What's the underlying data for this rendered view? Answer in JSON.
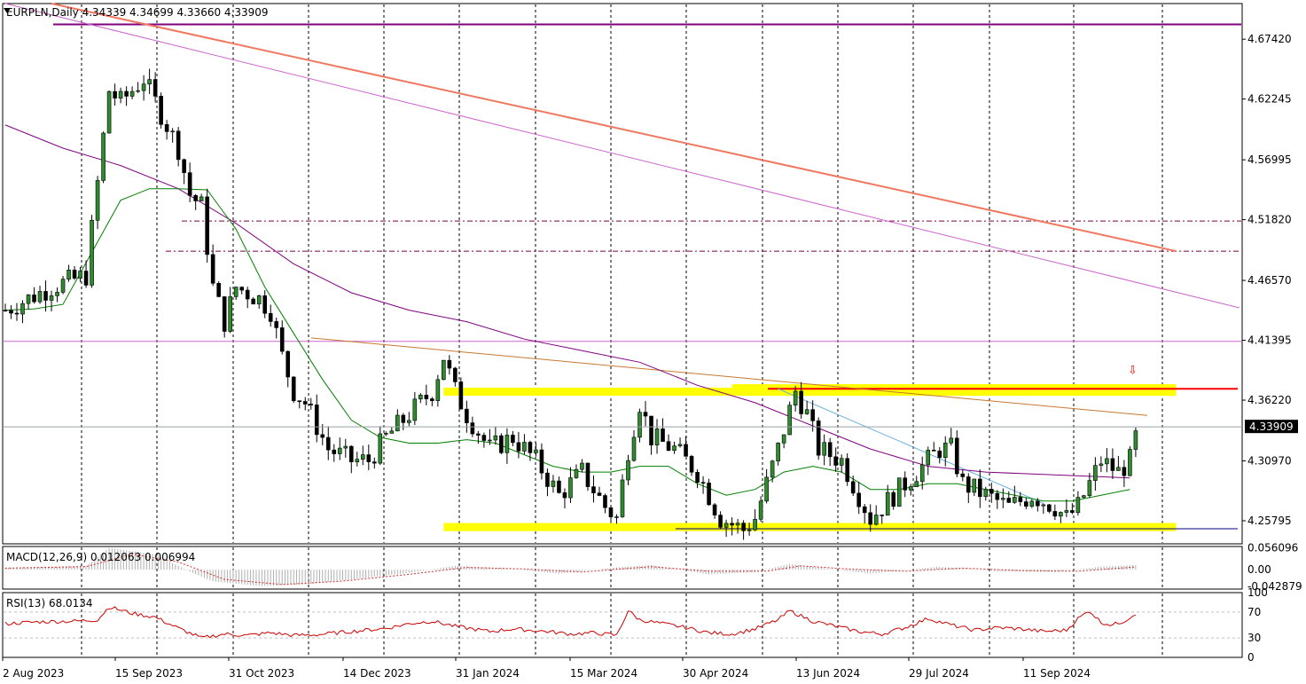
{
  "chart_data": [
    {
      "type": "candlestick",
      "symbol": "EURPLN",
      "timeframe": "Daily",
      "ohlc_header": {
        "open": "4.34339",
        "high": "4.34699",
        "low": "4.33660",
        "close": "4.33909"
      },
      "header_text": "EURPLN,Daily  4.34339 4.34699 4.33660 4.33909",
      "last_price": "4.33909",
      "ylim": [
        4.238,
        4.705
      ],
      "y_ticks": [
        "4.67420",
        "4.62245",
        "4.56995",
        "4.51820",
        "4.46570",
        "4.41395",
        "4.36220",
        "4.30970",
        "4.25795"
      ],
      "x_ticks": [
        "2 Aug 2023",
        "15 Sep 2023",
        "31 Oct 2023",
        "14 Dec 2023",
        "31 Jan 2024",
        "15 Mar 2024",
        "30 Apr 2024",
        "13 Jun 2024",
        "29 Jul 2024",
        "11 Sep 2024"
      ],
      "close_path": [
        [
          0,
          4.44
        ],
        [
          8,
          4.46
        ],
        [
          14,
          4.47
        ],
        [
          18,
          4.63
        ],
        [
          20,
          4.62
        ],
        [
          24,
          4.64
        ],
        [
          27,
          4.61
        ],
        [
          30,
          4.58
        ],
        [
          32,
          4.54
        ],
        [
          34,
          4.53
        ],
        [
          36,
          4.46
        ],
        [
          38,
          4.43
        ],
        [
          40,
          4.46
        ],
        [
          44,
          4.45
        ],
        [
          46,
          4.44
        ],
        [
          48,
          4.4
        ],
        [
          50,
          4.37
        ],
        [
          52,
          4.36
        ],
        [
          56,
          4.32
        ],
        [
          60,
          4.31
        ],
        [
          63,
          4.31
        ],
        [
          66,
          4.33
        ],
        [
          70,
          4.35
        ],
        [
          74,
          4.37
        ],
        [
          76,
          4.4
        ],
        [
          78,
          4.37
        ],
        [
          80,
          4.35
        ],
        [
          84,
          4.32
        ],
        [
          88,
          4.33
        ],
        [
          92,
          4.31
        ],
        [
          96,
          4.28
        ],
        [
          100,
          4.3
        ],
        [
          104,
          4.27
        ],
        [
          106,
          4.26
        ],
        [
          108,
          4.32
        ],
        [
          110,
          4.36
        ],
        [
          112,
          4.33
        ],
        [
          116,
          4.32
        ],
        [
          120,
          4.3
        ],
        [
          124,
          4.26
        ],
        [
          128,
          4.25
        ],
        [
          130,
          4.26
        ],
        [
          134,
          4.32
        ],
        [
          137,
          4.37
        ],
        [
          139,
          4.35
        ],
        [
          141,
          4.32
        ],
        [
          145,
          4.31
        ],
        [
          148,
          4.28
        ],
        [
          150,
          4.26
        ],
        [
          154,
          4.28
        ],
        [
          158,
          4.3
        ],
        [
          162,
          4.32
        ],
        [
          164,
          4.32
        ],
        [
          166,
          4.29
        ],
        [
          170,
          4.28
        ],
        [
          174,
          4.27
        ],
        [
          178,
          4.28
        ],
        [
          182,
          4.27
        ],
        [
          184,
          4.26
        ],
        [
          186,
          4.27
        ],
        [
          188,
          4.29
        ],
        [
          190,
          4.31
        ],
        [
          193,
          4.3
        ],
        [
          195,
          4.31
        ],
        [
          196,
          4.33
        ]
      ],
      "moving_averages": [
        {
          "color": "#800080",
          "points": [
            [
              0,
              4.6
            ],
            [
              10,
              4.58
            ],
            [
              20,
              4.565
            ],
            [
              30,
              4.545
            ],
            [
              40,
              4.515
            ],
            [
              50,
              4.48
            ],
            [
              60,
              4.455
            ],
            [
              70,
              4.44
            ],
            [
              80,
              4.43
            ],
            [
              90,
              4.415
            ],
            [
              100,
              4.405
            ],
            [
              110,
              4.395
            ],
            [
              120,
              4.375
            ],
            [
              130,
              4.36
            ],
            [
              140,
              4.34
            ],
            [
              150,
              4.32
            ],
            [
              160,
              4.305
            ],
            [
              170,
              4.3
            ],
            [
              180,
              4.298
            ],
            [
              190,
              4.296
            ],
            [
              195,
              4.295
            ]
          ]
        },
        {
          "color": "#008000",
          "points": [
            [
              0,
              4.44
            ],
            [
              5,
              4.441
            ],
            [
              10,
              4.445
            ],
            [
              15,
              4.49
            ],
            [
              20,
              4.535
            ],
            [
              25,
              4.545
            ],
            [
              30,
              4.545
            ],
            [
              35,
              4.544
            ],
            [
              40,
              4.51
            ],
            [
              45,
              4.46
            ],
            [
              50,
              4.42
            ],
            [
              55,
              4.38
            ],
            [
              60,
              4.345
            ],
            [
              65,
              4.33
            ],
            [
              70,
              4.325
            ],
            [
              75,
              4.325
            ],
            [
              80,
              4.328
            ],
            [
              85,
              4.325
            ],
            [
              90,
              4.315
            ],
            [
              95,
              4.305
            ],
            [
              100,
              4.3
            ],
            [
              105,
              4.3
            ],
            [
              110,
              4.305
            ],
            [
              115,
              4.305
            ],
            [
              120,
              4.29
            ],
            [
              125,
              4.28
            ],
            [
              130,
              4.285
            ],
            [
              135,
              4.3
            ],
            [
              140,
              4.305
            ],
            [
              145,
              4.3
            ],
            [
              150,
              4.285
            ],
            [
              155,
              4.285
            ],
            [
              160,
              4.29
            ],
            [
              165,
              4.29
            ],
            [
              170,
              4.285
            ],
            [
              175,
              4.28
            ],
            [
              180,
              4.275
            ],
            [
              185,
              4.275
            ],
            [
              190,
              4.28
            ],
            [
              195,
              4.285
            ]
          ]
        }
      ],
      "horizontal_levels": [
        {
          "price": 4.687,
          "color": "#800080",
          "style": "solid"
        },
        {
          "price": 4.517,
          "color": "#800040",
          "style": "dashdot"
        },
        {
          "price": 4.491,
          "color": "#800040",
          "style": "dashdot"
        },
        {
          "price": 4.413,
          "color": "#cc66cc",
          "style": "solid"
        },
        {
          "price": 4.372,
          "color": "#ff0000",
          "style": "solid"
        },
        {
          "price": 4.251,
          "color": "#00008b",
          "style": "solid"
        }
      ],
      "zones": [
        {
          "from_x": 76,
          "to_x": 203,
          "top": 4.373,
          "bottom": 4.366,
          "color": "#ffff00"
        },
        {
          "from_x": 126,
          "to_x": 203,
          "top": 4.376,
          "bottom": 4.366,
          "color": "#ffff00"
        },
        {
          "from_x": 76,
          "to_x": 203,
          "top": 4.256,
          "bottom": 4.249,
          "color": "#ffff00"
        }
      ],
      "trendlines": [
        {
          "from": [
            8,
            4.705
          ],
          "to": [
            203,
            4.491
          ],
          "color": "#f07860",
          "width": 2
        },
        {
          "from": [
            0,
            4.705
          ],
          "to": [
            214,
            4.442
          ],
          "color": "#cc66cc",
          "width": 1
        },
        {
          "from": [
            53,
            4.416
          ],
          "to": [
            198,
            4.349
          ],
          "color": "#c87830",
          "width": 1
        },
        {
          "from": [
            134,
            4.372
          ],
          "to": [
            180,
            4.273
          ],
          "color": "#6ab0e0",
          "width": 1
        }
      ],
      "arrow_marker": {
        "x": 185,
        "price": 4.388,
        "color": "#ff0000",
        "glyph": "⇩"
      }
    },
    {
      "type": "histogram",
      "indicator": "MACD(12,26,9)",
      "label": "MACD(12,26,9) 0.012063 0.006994",
      "values_text": [
        "0.012063",
        "0.006994"
      ],
      "ylim": [
        -0.05,
        0.06
      ],
      "y_ticks": [
        "0.056096",
        "0.00",
        "-0.042879"
      ],
      "histogram_path": [
        [
          0,
          0.005
        ],
        [
          14,
          0.01
        ],
        [
          18,
          0.056
        ],
        [
          26,
          0.04
        ],
        [
          32,
          -0.005
        ],
        [
          36,
          -0.03
        ],
        [
          44,
          -0.042
        ],
        [
          52,
          -0.038
        ],
        [
          60,
          -0.025
        ],
        [
          70,
          -0.008
        ],
        [
          78,
          0.01
        ],
        [
          86,
          0.004
        ],
        [
          96,
          -0.01
        ],
        [
          106,
          0.006
        ],
        [
          112,
          0.012
        ],
        [
          122,
          -0.012
        ],
        [
          130,
          -0.006
        ],
        [
          136,
          0.015
        ],
        [
          142,
          0.004
        ],
        [
          150,
          -0.01
        ],
        [
          162,
          0.008
        ],
        [
          172,
          -0.004
        ],
        [
          182,
          -0.006
        ],
        [
          190,
          0.008
        ],
        [
          196,
          0.012
        ]
      ],
      "signal_path": [
        [
          0,
          0.004
        ],
        [
          14,
          0.008
        ],
        [
          22,
          0.04
        ],
        [
          30,
          0.02
        ],
        [
          38,
          -0.025
        ],
        [
          48,
          -0.038
        ],
        [
          58,
          -0.03
        ],
        [
          70,
          -0.012
        ],
        [
          80,
          0.006
        ],
        [
          90,
          0.002
        ],
        [
          100,
          -0.006
        ],
        [
          112,
          0.008
        ],
        [
          122,
          -0.004
        ],
        [
          132,
          -0.004
        ],
        [
          138,
          0.01
        ],
        [
          146,
          0.002
        ],
        [
          156,
          -0.004
        ],
        [
          166,
          0.004
        ],
        [
          176,
          -0.002
        ],
        [
          186,
          -0.004
        ],
        [
          196,
          0.007
        ]
      ]
    },
    {
      "type": "line",
      "indicator": "RSI(13)",
      "label": "RSI(13) 68.0134",
      "value_text": "68.0134",
      "ylim": [
        0,
        100
      ],
      "y_ticks": [
        "100",
        "70",
        "30",
        "0"
      ],
      "levels": [
        70,
        30
      ],
      "series": [
        {
          "values_path": [
            [
              0,
              52
            ],
            [
              6,
              55
            ],
            [
              12,
              56
            ],
            [
              16,
              58
            ],
            [
              18,
              78
            ],
            [
              22,
              68
            ],
            [
              26,
              62
            ],
            [
              30,
              45
            ],
            [
              34,
              30
            ],
            [
              38,
              36
            ],
            [
              42,
              34
            ],
            [
              46,
              38
            ],
            [
              50,
              34
            ],
            [
              54,
              35
            ],
            [
              60,
              40
            ],
            [
              66,
              45
            ],
            [
              70,
              52
            ],
            [
              74,
              56
            ],
            [
              78,
              48
            ],
            [
              84,
              40
            ],
            [
              88,
              44
            ],
            [
              94,
              40
            ],
            [
              98,
              36
            ],
            [
              102,
              38
            ],
            [
              106,
              34
            ],
            [
              108,
              72
            ],
            [
              110,
              58
            ],
            [
              114,
              52
            ],
            [
              118,
              46
            ],
            [
              122,
              38
            ],
            [
              126,
              36
            ],
            [
              130,
              44
            ],
            [
              134,
              58
            ],
            [
              136,
              72
            ],
            [
              140,
              56
            ],
            [
              144,
              48
            ],
            [
              148,
              40
            ],
            [
              152,
              36
            ],
            [
              156,
              46
            ],
            [
              160,
              60
            ],
            [
              164,
              50
            ],
            [
              168,
              42
            ],
            [
              172,
              46
            ],
            [
              176,
              44
            ],
            [
              180,
              40
            ],
            [
              184,
              42
            ],
            [
              186,
              60
            ],
            [
              188,
              72
            ],
            [
              190,
              54
            ],
            [
              192,
              50
            ],
            [
              194,
              56
            ],
            [
              196,
              68
            ]
          ]
        }
      ]
    }
  ]
}
